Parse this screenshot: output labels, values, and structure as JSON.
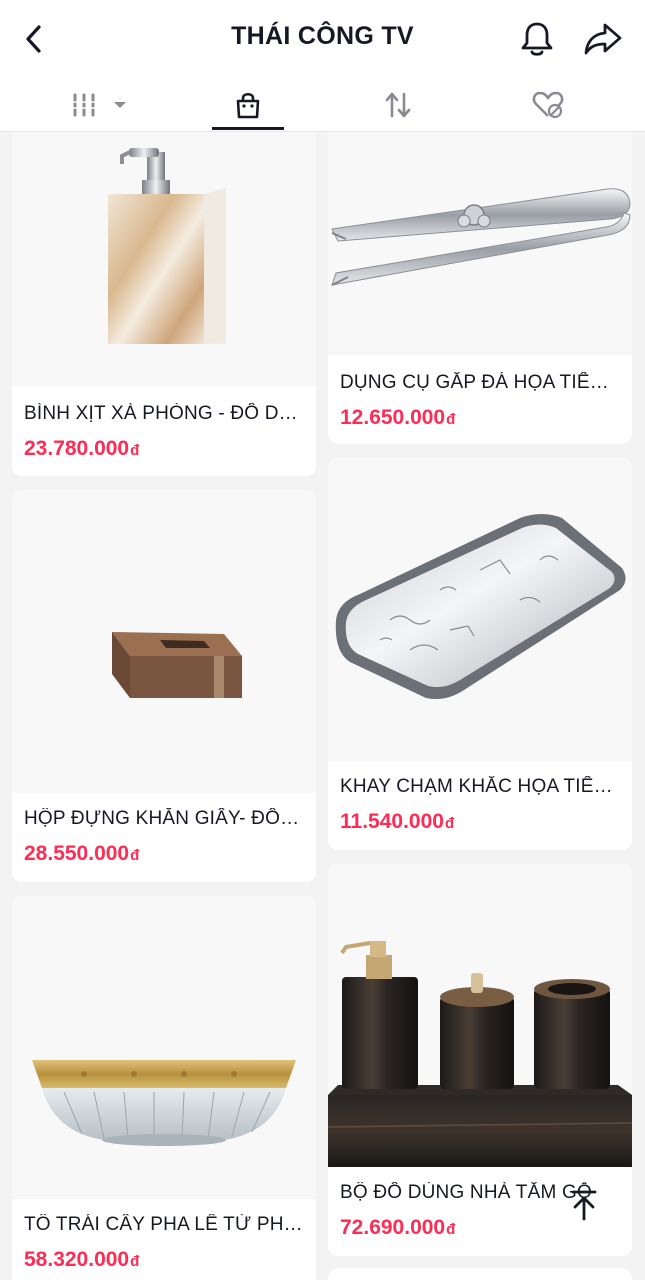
{
  "header": {
    "title": "THÁI CÔNG TV",
    "back_icon": "chevron-left-icon",
    "bell_icon": "bell-icon",
    "share_icon": "share-arrow-icon"
  },
  "tabs": [
    {
      "name": "videos-grid",
      "icon": "grid-bars-icon",
      "has_dropdown": true
    },
    {
      "name": "shop",
      "icon": "shopping-bag-icon",
      "active": true
    },
    {
      "name": "reposts",
      "icon": "repost-icon"
    },
    {
      "name": "liked",
      "icon": "hidden-heart-icon"
    }
  ],
  "products": [
    {
      "name": "BÌNH XỊT XÀ PHÒNG - ĐỒ DÙNG",
      "price": "23.780.000",
      "currency": "đ"
    },
    {
      "name": "DỤNG CỤ GẮP ĐÁ HỌA TIẾT HOA",
      "price": "12.650.000",
      "currency": "đ"
    },
    {
      "name": "HỘP ĐỰNG KHĂN GIẤY- ĐỒ DÙNG",
      "price": "28.550.000",
      "currency": "đ"
    },
    {
      "name": "KHAY CHẠM KHẮC HỌA TIẾT CHỮ",
      "price": "11.540.000",
      "currency": "đ"
    },
    {
      "name": "TÔ TRÁI CÂY PHA LÊ TỪ PHÁP",
      "price": "58.320.000",
      "currency": "đ"
    },
    {
      "name": "BỘ ĐỒ DÙNG NHÀ TẮM GỖ",
      "price": "72.690.000",
      "currency": "đ"
    }
  ],
  "colors": {
    "price": "#fe2c55",
    "text": "#161823",
    "background": "#f3f3f4"
  }
}
